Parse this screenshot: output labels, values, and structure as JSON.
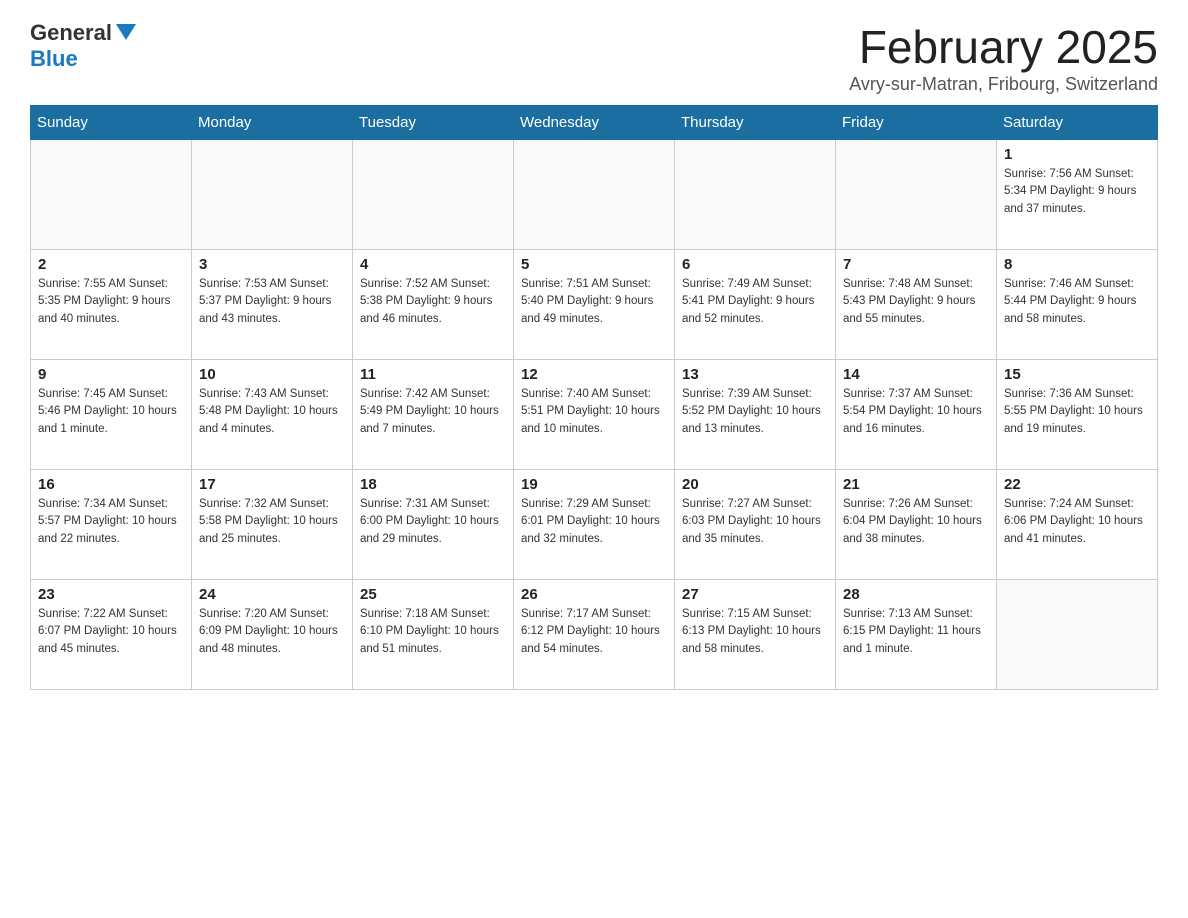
{
  "logo": {
    "general": "General",
    "blue": "Blue"
  },
  "title": {
    "month_year": "February 2025",
    "location": "Avry-sur-Matran, Fribourg, Switzerland"
  },
  "weekdays": [
    "Sunday",
    "Monday",
    "Tuesday",
    "Wednesday",
    "Thursday",
    "Friday",
    "Saturday"
  ],
  "weeks": [
    [
      {
        "day": "",
        "detail": ""
      },
      {
        "day": "",
        "detail": ""
      },
      {
        "day": "",
        "detail": ""
      },
      {
        "day": "",
        "detail": ""
      },
      {
        "day": "",
        "detail": ""
      },
      {
        "day": "",
        "detail": ""
      },
      {
        "day": "1",
        "detail": "Sunrise: 7:56 AM\nSunset: 5:34 PM\nDaylight: 9 hours\nand 37 minutes."
      }
    ],
    [
      {
        "day": "2",
        "detail": "Sunrise: 7:55 AM\nSunset: 5:35 PM\nDaylight: 9 hours\nand 40 minutes."
      },
      {
        "day": "3",
        "detail": "Sunrise: 7:53 AM\nSunset: 5:37 PM\nDaylight: 9 hours\nand 43 minutes."
      },
      {
        "day": "4",
        "detail": "Sunrise: 7:52 AM\nSunset: 5:38 PM\nDaylight: 9 hours\nand 46 minutes."
      },
      {
        "day": "5",
        "detail": "Sunrise: 7:51 AM\nSunset: 5:40 PM\nDaylight: 9 hours\nand 49 minutes."
      },
      {
        "day": "6",
        "detail": "Sunrise: 7:49 AM\nSunset: 5:41 PM\nDaylight: 9 hours\nand 52 minutes."
      },
      {
        "day": "7",
        "detail": "Sunrise: 7:48 AM\nSunset: 5:43 PM\nDaylight: 9 hours\nand 55 minutes."
      },
      {
        "day": "8",
        "detail": "Sunrise: 7:46 AM\nSunset: 5:44 PM\nDaylight: 9 hours\nand 58 minutes."
      }
    ],
    [
      {
        "day": "9",
        "detail": "Sunrise: 7:45 AM\nSunset: 5:46 PM\nDaylight: 10 hours\nand 1 minute."
      },
      {
        "day": "10",
        "detail": "Sunrise: 7:43 AM\nSunset: 5:48 PM\nDaylight: 10 hours\nand 4 minutes."
      },
      {
        "day": "11",
        "detail": "Sunrise: 7:42 AM\nSunset: 5:49 PM\nDaylight: 10 hours\nand 7 minutes."
      },
      {
        "day": "12",
        "detail": "Sunrise: 7:40 AM\nSunset: 5:51 PM\nDaylight: 10 hours\nand 10 minutes."
      },
      {
        "day": "13",
        "detail": "Sunrise: 7:39 AM\nSunset: 5:52 PM\nDaylight: 10 hours\nand 13 minutes."
      },
      {
        "day": "14",
        "detail": "Sunrise: 7:37 AM\nSunset: 5:54 PM\nDaylight: 10 hours\nand 16 minutes."
      },
      {
        "day": "15",
        "detail": "Sunrise: 7:36 AM\nSunset: 5:55 PM\nDaylight: 10 hours\nand 19 minutes."
      }
    ],
    [
      {
        "day": "16",
        "detail": "Sunrise: 7:34 AM\nSunset: 5:57 PM\nDaylight: 10 hours\nand 22 minutes."
      },
      {
        "day": "17",
        "detail": "Sunrise: 7:32 AM\nSunset: 5:58 PM\nDaylight: 10 hours\nand 25 minutes."
      },
      {
        "day": "18",
        "detail": "Sunrise: 7:31 AM\nSunset: 6:00 PM\nDaylight: 10 hours\nand 29 minutes."
      },
      {
        "day": "19",
        "detail": "Sunrise: 7:29 AM\nSunset: 6:01 PM\nDaylight: 10 hours\nand 32 minutes."
      },
      {
        "day": "20",
        "detail": "Sunrise: 7:27 AM\nSunset: 6:03 PM\nDaylight: 10 hours\nand 35 minutes."
      },
      {
        "day": "21",
        "detail": "Sunrise: 7:26 AM\nSunset: 6:04 PM\nDaylight: 10 hours\nand 38 minutes."
      },
      {
        "day": "22",
        "detail": "Sunrise: 7:24 AM\nSunset: 6:06 PM\nDaylight: 10 hours\nand 41 minutes."
      }
    ],
    [
      {
        "day": "23",
        "detail": "Sunrise: 7:22 AM\nSunset: 6:07 PM\nDaylight: 10 hours\nand 45 minutes."
      },
      {
        "day": "24",
        "detail": "Sunrise: 7:20 AM\nSunset: 6:09 PM\nDaylight: 10 hours\nand 48 minutes."
      },
      {
        "day": "25",
        "detail": "Sunrise: 7:18 AM\nSunset: 6:10 PM\nDaylight: 10 hours\nand 51 minutes."
      },
      {
        "day": "26",
        "detail": "Sunrise: 7:17 AM\nSunset: 6:12 PM\nDaylight: 10 hours\nand 54 minutes."
      },
      {
        "day": "27",
        "detail": "Sunrise: 7:15 AM\nSunset: 6:13 PM\nDaylight: 10 hours\nand 58 minutes."
      },
      {
        "day": "28",
        "detail": "Sunrise: 7:13 AM\nSunset: 6:15 PM\nDaylight: 11 hours\nand 1 minute."
      },
      {
        "day": "",
        "detail": ""
      }
    ]
  ]
}
